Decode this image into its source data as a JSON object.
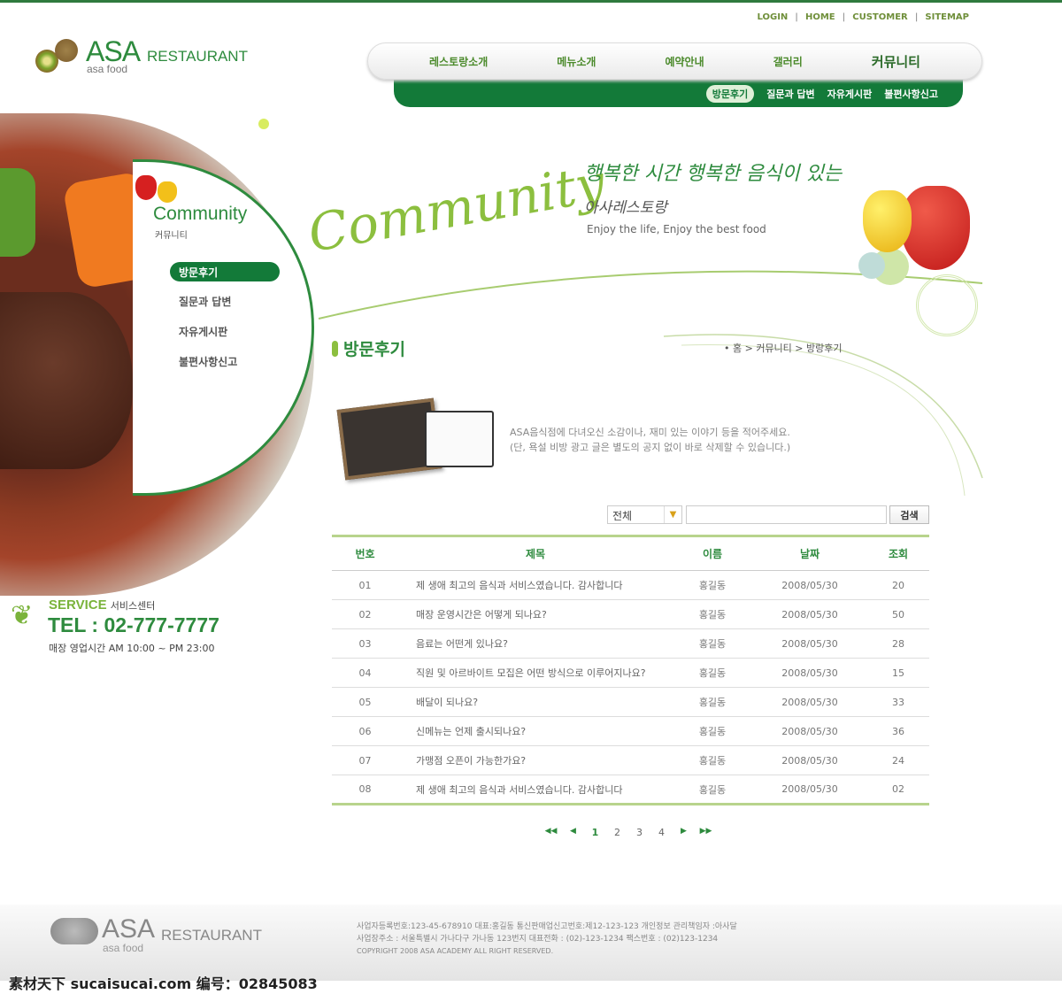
{
  "util_links": [
    "LOGIN",
    "HOME",
    "CUSTOMER",
    "SITEMAP"
  ],
  "logo": {
    "main": "ASA",
    "restaurant": "RESTAURANT",
    "sub": "asa food"
  },
  "nav": [
    "레스토랑소개",
    "메뉴소개",
    "예약안내",
    "갤러리",
    "커뮤니티"
  ],
  "subnav": [
    "방문후기",
    "질문과 답변",
    "자유게시판",
    "불편사항신고"
  ],
  "side": {
    "title": "Community",
    "subtitle": "커뮤니티",
    "items": [
      "방문후기",
      "질문과 답변",
      "자유게시판",
      "불편사항신고"
    ]
  },
  "service": {
    "label": "SERVICE",
    "label_kr": "서비스센터",
    "tel": "TEL : 02-777-7777",
    "hours": "매장 영업시간 AM 10:00 ~ PM 23:00"
  },
  "banner": {
    "line1": "행복한 시간 행복한 음식이 있는",
    "line2": "아사레스토랑",
    "line3": "Enjoy the life, Enjoy the best food",
    "big": "Community"
  },
  "page_title": "방문후기",
  "breadcrumb": "• 홈 > 커뮤니티 > 방랑후기",
  "notice": [
    "ASA음식점에 다녀오신 소감이나, 재미 있는 이야기 등을 적어주세요.",
    "(단, 욕설 비방 광고 글은 별도의 공지 없이 바로 삭제할 수 있습니다.)"
  ],
  "search": {
    "select": "전체",
    "value": "",
    "button": "검색"
  },
  "table": {
    "headers": [
      "번호",
      "제목",
      "이름",
      "날짜",
      "조회"
    ],
    "rows": [
      [
        "01",
        "제 생애 최고의 음식과 서비스였습니다. 감사합니다",
        "홍길동",
        "2008/05/30",
        "20"
      ],
      [
        "02",
        "매장 운영시간은 어떻게 되나요?",
        "홍길동",
        "2008/05/30",
        "50"
      ],
      [
        "03",
        "음료는 어떤게 있나요?",
        "홍길동",
        "2008/05/30",
        "28"
      ],
      [
        "04",
        "직원 및 아르바이트 모집은 어떤 방식으로 이루어지나요?",
        "홍길동",
        "2008/05/30",
        "15"
      ],
      [
        "05",
        "배달이 되나요?",
        "홍길동",
        "2008/05/30",
        "33"
      ],
      [
        "06",
        "신메뉴는 언제 출시되나요?",
        "홍길동",
        "2008/05/30",
        "36"
      ],
      [
        "07",
        "가맹점 오픈이 가능한가요?",
        "홍길동",
        "2008/05/30",
        "24"
      ],
      [
        "08",
        "제 생애 최고의 음식과 서비스였습니다. 감사합니다",
        "홍길동",
        "2008/05/30",
        "02"
      ]
    ]
  },
  "pager": {
    "first": "◀◀",
    "prev": "◀",
    "pages": [
      "1",
      "2",
      "3",
      "4"
    ],
    "current": "1",
    "next": "▶",
    "last": "▶▶"
  },
  "footer": {
    "logo_main": "ASA",
    "logo_restaurant": "RESTAURANT",
    "logo_sub": "asa food",
    "line1": "사업자등록번호:123-45-678910   대표:홍길동   통신판매업신고번호:제12-123-123   개인정보 관리책임자 :아사달",
    "line2": "사업장주소 : 서울특별시 가나다구 가나동 123번지   대표전화 : (02)-123-1234   팩스번호 : (02)123-1234",
    "copyright": "COPYRIGHT 2008 ASA ACADEMY  ALL RIGHT RESERVED."
  },
  "watermark": "素材天下 sucaisucai.com  编号：02845083",
  "colors": {
    "brand_green": "#137a39",
    "light_green": "#8cbf3f",
    "text_green": "#2e8b3e"
  }
}
